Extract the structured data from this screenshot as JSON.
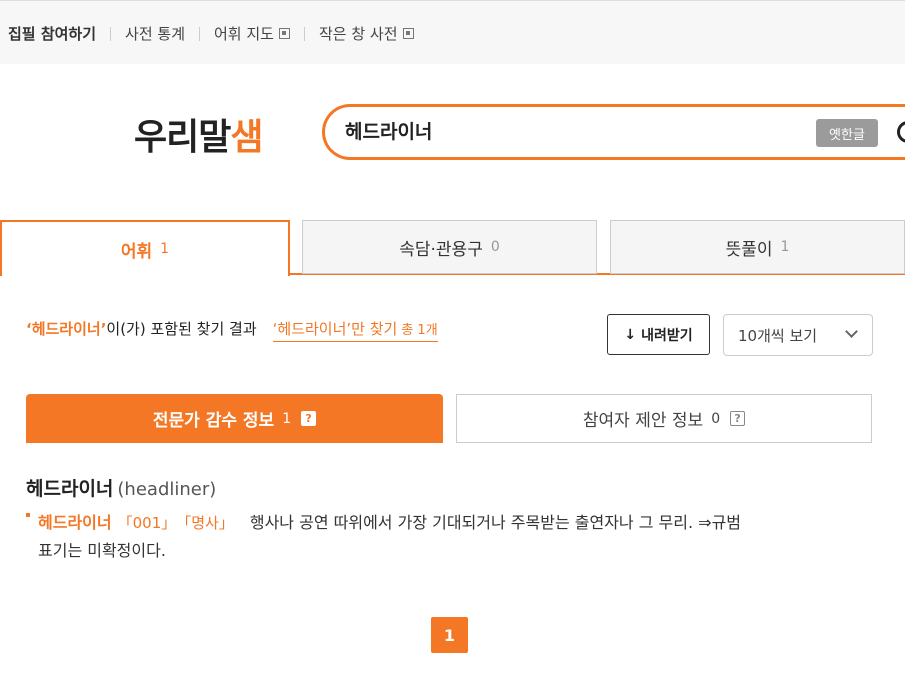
{
  "topnav": {
    "items": [
      {
        "label": "집필 참여하기"
      },
      {
        "label": "사전 통계"
      },
      {
        "label": "어휘 지도"
      },
      {
        "label": "작은 창 사전"
      }
    ]
  },
  "logo": {
    "text_main": "우리말",
    "text_last": "샘"
  },
  "search": {
    "value": "헤드라이너",
    "old_hangul_label": "옛한글"
  },
  "tabs": [
    {
      "label": "어휘",
      "count": "1"
    },
    {
      "label": "속담·관용구",
      "count": "0"
    },
    {
      "label": "뜻풀이",
      "count": "1"
    }
  ],
  "results": {
    "keyword": "‘헤드라이너’",
    "suffix": "이(가) 포함된 찾기 결과",
    "only_label": "‘헤드라이너’만 찾기",
    "total": "총 1개"
  },
  "toolbar": {
    "download_label": "내려받기",
    "page_size": "10개씩 보기"
  },
  "subtabs": [
    {
      "label": "전문가 감수 정보",
      "count": "1"
    },
    {
      "label": "참여자 제안 정보",
      "count": "0"
    }
  ],
  "entry": {
    "word": "헤드라이너",
    "origin": "(headliner)",
    "def_word": "헤드라이너",
    "tag1": "「001」",
    "tag2": "「명사」",
    "definition_line1": "행사나 공연 따위에서 가장 기대되거나 주목받는 출연자나 그 무리. ⇒규범",
    "definition_line2": "표기는 미확정이다."
  },
  "pager": {
    "current": "1"
  },
  "colors": {
    "accent": "#f47725"
  }
}
